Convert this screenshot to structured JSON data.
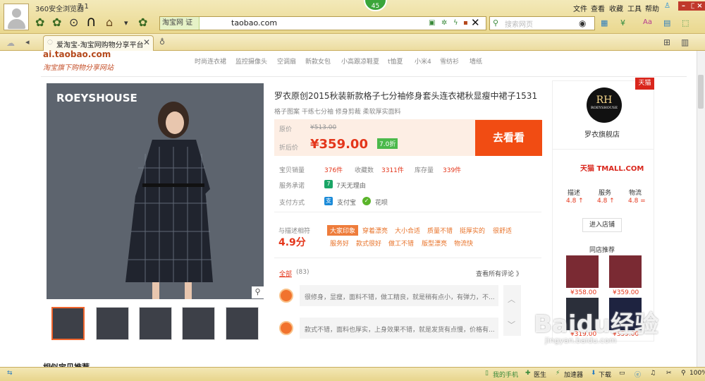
{
  "browser": {
    "app_name": "360安全浏览器",
    "version": "7.1",
    "notify_count": "45",
    "address_tag": "淘宝网 证",
    "address": "taobao.com",
    "search_placeholder": "搜索网页",
    "menu": [
      "文件",
      "查看",
      "收藏",
      "工具",
      "帮助"
    ],
    "tab_label": "爱淘宝-淘宝网购物分享平台"
  },
  "site": {
    "url": "ai.taobao.com",
    "slogan": "淘宝旗下购物分享网站",
    "nav": [
      "时尚连衣裙",
      "监控摄像头",
      "空调扇",
      "新款女包",
      "小高跟凉鞋夏",
      "t恤夏",
      "小米4",
      "雪纺衫",
      "墙纸"
    ]
  },
  "product": {
    "brand_text": "ROEYSHOUSE",
    "title": "罗衣原创2015秋装新款格子七分袖修身套头连衣裙秋显瘦中裙子1531",
    "subtitle": "格子图案 干练七分袖 修身剪裁 柔软厚实面料",
    "orig_label": "原价",
    "orig_price": "¥513.00",
    "sale_label": "折后价",
    "sale_price": "¥359.00",
    "discount": "7.0折",
    "buy_label": "去看看",
    "stats": {
      "sold_label": "宝贝销量",
      "sold": "376件",
      "fav_label": "收藏数",
      "fav": "3311件",
      "stock_label": "库存量",
      "stock": "339件"
    },
    "service_label": "服务承诺",
    "service_badge": "7",
    "service": "7天无理由",
    "pay_label": "支付方式",
    "pay1": "支付宝",
    "pay2": "花呗",
    "rating_label": "与描述相符",
    "rating": "4.9分",
    "tags": [
      "大家印象",
      "穿着漂亮",
      "大小合适",
      "质量不错",
      "挺厚实的",
      "很舒适",
      "服务好",
      "款式很好",
      "做工不错",
      "版型漂亮",
      "物流快"
    ],
    "reviews_all": "全部",
    "reviews_count": "(83)",
    "view_all": "查看所有评论 》",
    "reviews": [
      "很修身，显瘦，面料不错，做工精良，就是稍有点小，有弹力，不...",
      "款式不错，面料也厚实，上身效果不错，就是发货有点慢，价格有..."
    ]
  },
  "store": {
    "tmall_tag": "天猫",
    "logo_text": "RH",
    "logo_sub": "ROEYSHOUSE",
    "name": "罗衣旗舰店",
    "tmall_logo": "天猫 TMALL.COM",
    "scores": [
      {
        "label": "描述",
        "value": "4.8 ↑"
      },
      {
        "label": "服务",
        "value": "4.8 ↑"
      },
      {
        "label": "物流",
        "value": "4.8 ="
      }
    ],
    "enter_label": "进入店铺",
    "rec_title": "同店推荐",
    "rec_prices": [
      "¥358.00",
      "¥359.00",
      "¥319.00",
      "¥359.00"
    ]
  },
  "similar_title": "相似宝贝推荐",
  "status": {
    "phone": "我的手机",
    "doctor": "医生",
    "accelerator": "加速器",
    "download": "下载",
    "zoom": "100%"
  },
  "watermark": "Baidu经验",
  "watermark_sub": "jingyan.baidu.com"
}
